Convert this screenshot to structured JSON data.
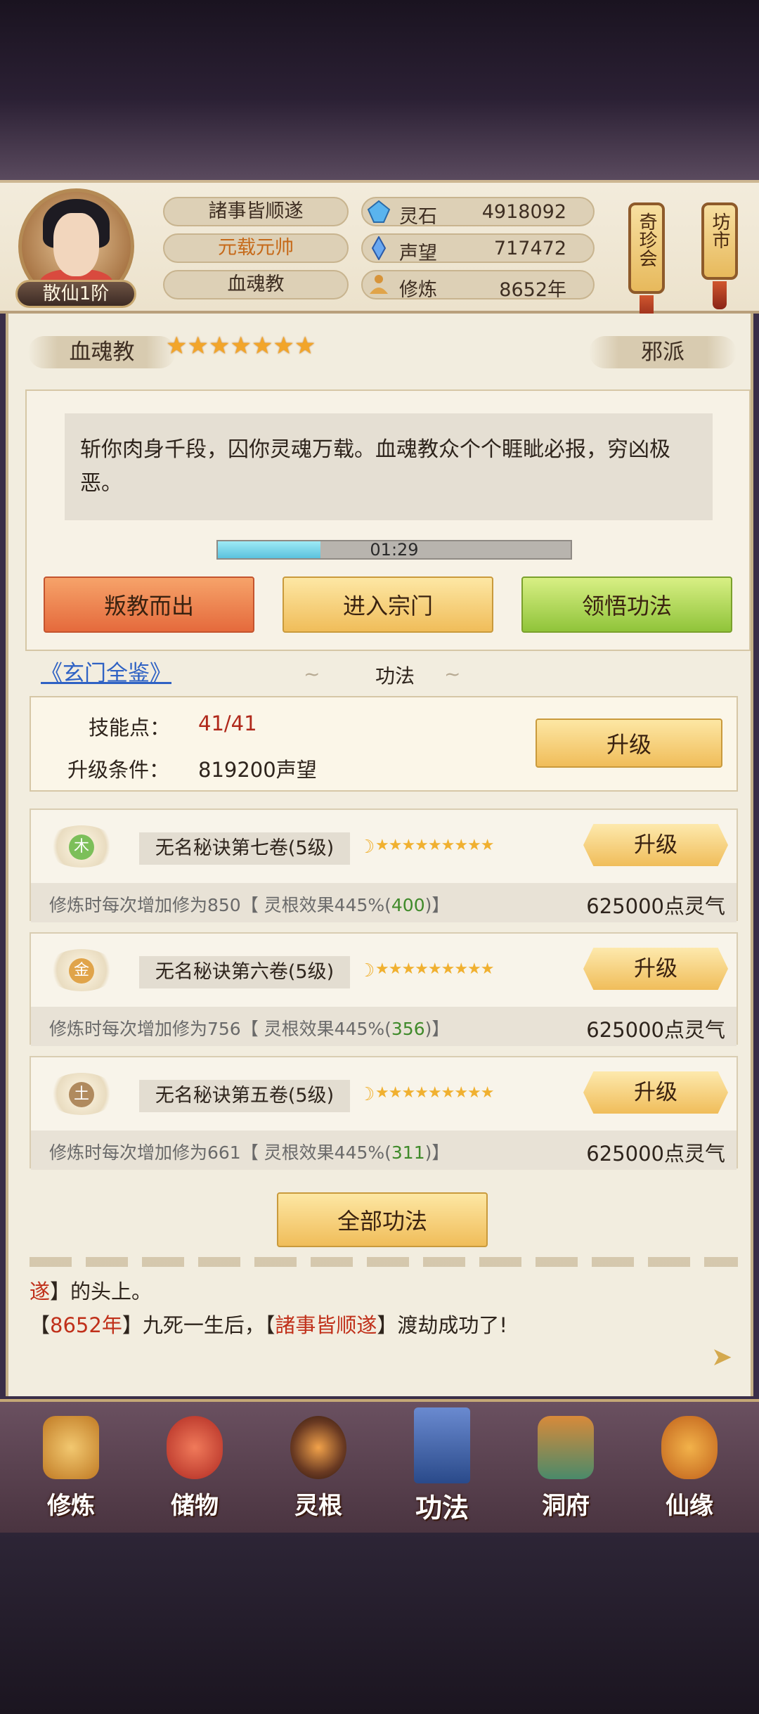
{
  "header": {
    "rank": "散仙1阶",
    "title1": "諸事皆顺遂",
    "title2": "元载元帅",
    "sect": "血魂教",
    "resources": [
      {
        "label": "灵石",
        "value": "4918092",
        "icon": "spirit-stone-icon"
      },
      {
        "label": "声望",
        "value": "717472",
        "icon": "prestige-crystal-icon"
      },
      {
        "label": "修炼",
        "value": "8652年",
        "icon": "cultivation-meditation-icon"
      }
    ],
    "side_buttons": [
      "奇珍会",
      "坊市"
    ]
  },
  "sect_panel": {
    "name": "血魂教",
    "stars": 7,
    "alignment": "邪派",
    "quote": "斩你肉身千段，囚你灵魂万载。血魂教众个个睚眦必报，穷凶极恶。",
    "timer": "01:29",
    "timer_progress": 0.29,
    "buttons": [
      "叛教而出",
      "进入宗门",
      "领悟功法"
    ]
  },
  "skills_section": {
    "link": "《玄门全鉴》",
    "title": "功法",
    "skill_points_label": "技能点：",
    "skill_points_value": "41/41",
    "upgrade_cond_label": "升级条件：",
    "upgrade_cond_value": "819200声望",
    "upgrade_label": "升级",
    "items": [
      {
        "element": "木",
        "element_color": "#7cbf5a",
        "name": "无名秘诀第七卷(5级)",
        "desc_prefix": "修炼时每次增加修为850【 灵根效果445%(",
        "bonus": "400",
        "desc_suffix": ")】",
        "cost": "625000点灵气",
        "upgrade": "升级"
      },
      {
        "element": "金",
        "element_color": "#e0a44a",
        "name": "无名秘诀第六卷(5级)",
        "desc_prefix": "修炼时每次增加修为756【 灵根效果445%(",
        "bonus": "356",
        "desc_suffix": ")】",
        "cost": "625000点灵气",
        "upgrade": "升级"
      },
      {
        "element": "土",
        "element_color": "#b08a5e",
        "name": "无名秘诀第五卷(5级)",
        "desc_prefix": "修炼时每次增加修为661【 灵根效果445%(",
        "bonus": "311",
        "desc_suffix": ")】",
        "cost": "625000点灵气",
        "upgrade": "升级"
      }
    ],
    "all_button": "全部功法"
  },
  "log": {
    "line1_red": "遂",
    "line1_rest": "】的头上。",
    "line2_open": "【",
    "line2_year": "8652年",
    "line2_mid": "】九死一生后，【",
    "line2_name": "諸事皆顺遂",
    "line2_end": "】渡劫成功了!"
  },
  "nav": [
    {
      "label": "修炼",
      "icon": "cultivate-icon",
      "color": "#d9a23a"
    },
    {
      "label": "储物",
      "icon": "storage-bag-icon",
      "color": "#d2463a"
    },
    {
      "label": "灵根",
      "icon": "spirit-root-icon",
      "color": "#6a3a22"
    },
    {
      "label": "功法",
      "icon": "skill-book-icon",
      "color": "#3a5a9a"
    },
    {
      "label": "洞府",
      "icon": "cave-mansion-icon",
      "color": "#4a8a6a"
    },
    {
      "label": "仙缘",
      "icon": "gourd-icon",
      "color": "#d98a2a"
    }
  ]
}
